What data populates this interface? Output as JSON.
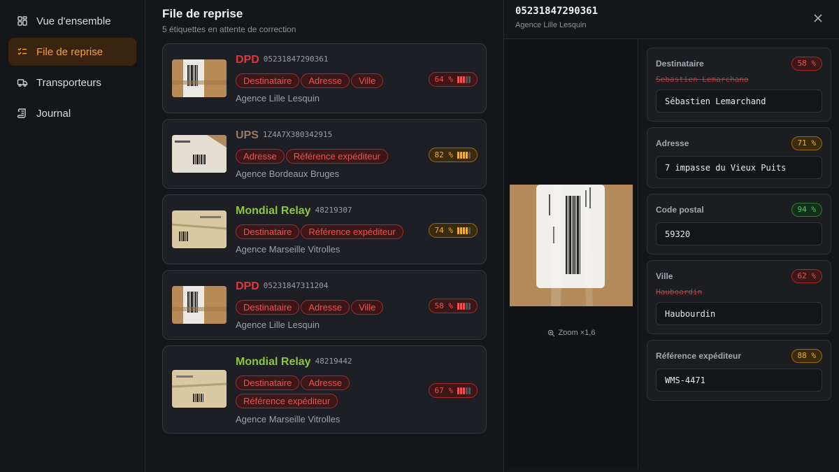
{
  "sidebar": {
    "items": [
      {
        "label": "Vue d'ensemble",
        "icon": "dashboard-icon",
        "active": false
      },
      {
        "label": "File de reprise",
        "icon": "checklist-icon",
        "active": true
      },
      {
        "label": "Transporteurs",
        "icon": "truck-icon",
        "active": false
      },
      {
        "label": "Journal",
        "icon": "scroll-icon",
        "active": false
      }
    ]
  },
  "queue": {
    "title": "File de reprise",
    "subtitle": "5 étiquettes en attente de correction",
    "cards": [
      {
        "carrier": "DPD",
        "tracking": "05231847290361",
        "tags": [
          "Destinataire",
          "Adresse",
          "Ville"
        ],
        "score": "64 %",
        "score_level": 0.64,
        "agency": "Agence Lille Lesquin"
      },
      {
        "carrier": "UPS",
        "tracking": "1Z4A7X380342915",
        "tags": [
          "Adresse",
          "Référence expéditeur"
        ],
        "score": "82 %",
        "score_level": 0.82,
        "agency": "Agence Bordeaux Bruges"
      },
      {
        "carrier": "Mondial Relay",
        "tracking": "48219307",
        "tags": [
          "Destinataire",
          "Référence expéditeur"
        ],
        "score": "74 %",
        "score_level": 0.74,
        "agency": "Agence Marseille Vitrolles"
      },
      {
        "carrier": "DPD",
        "tracking": "05231847311204",
        "tags": [
          "Destinataire",
          "Adresse",
          "Ville"
        ],
        "score": "58 %",
        "score_level": 0.58,
        "agency": "Agence Lille Lesquin"
      },
      {
        "carrier": "Mondial Relay",
        "tracking": "48219442",
        "tags": [
          "Destinataire",
          "Adresse",
          "Référence expéditeur"
        ],
        "score": "67 %",
        "score_level": 0.67,
        "agency": "Agence Marseille Vitrolles"
      }
    ]
  },
  "detail": {
    "tracking": "05231847290361",
    "agency": "Agence Lille Lesquin",
    "zoom": "Zoom ×1,6",
    "fields": [
      {
        "label": "Destinataire",
        "score": "58 %",
        "original": "Sebastien Lemarchano",
        "value": "Sébastien Lemarchand"
      },
      {
        "label": "Adresse",
        "score": "71 %",
        "original": "",
        "value": "7 impasse du Vieux Puits"
      },
      {
        "label": "Code postal",
        "score": "94 %",
        "original": "",
        "value": "59320"
      },
      {
        "label": "Ville",
        "score": "62 %",
        "original": "Hauboardin",
        "value": "Haubourdin"
      },
      {
        "label": "Référence expéditeur",
        "score": "88 %",
        "original": "",
        "value": "WMS-4471"
      }
    ]
  },
  "colors": {
    "accent": "#f0a040",
    "error": "#f25050",
    "warning": "#f0b030",
    "success": "#4cc760",
    "dpd": "#e0363b",
    "ups": "#9a7b64",
    "mondial_relay": "#8cc63f"
  }
}
